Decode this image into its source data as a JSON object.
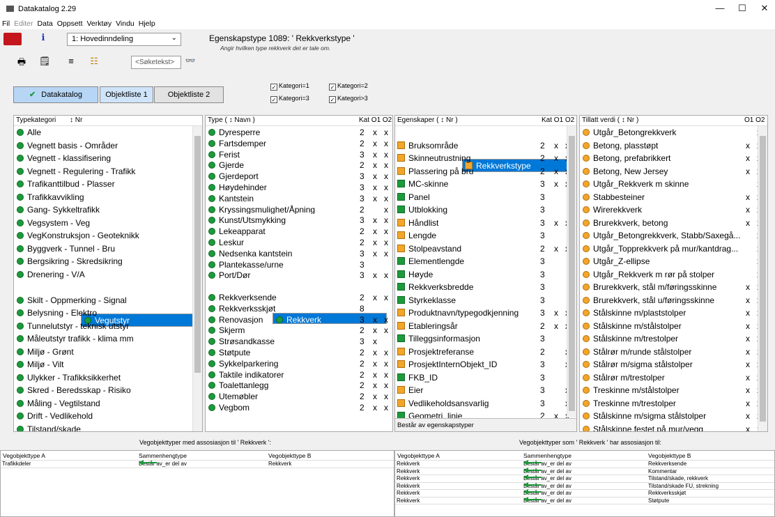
{
  "window": {
    "title": "Datakatalog 2.29",
    "min": "—",
    "max": "☐",
    "close": "✕"
  },
  "menu": [
    {
      "label": "Fil",
      "disabled": false
    },
    {
      "label": "Editer",
      "disabled": true
    },
    {
      "label": "Data",
      "disabled": false
    },
    {
      "label": "Oppsett",
      "disabled": false
    },
    {
      "label": "Verktøy",
      "disabled": false
    },
    {
      "label": "Vindu",
      "disabled": false
    },
    {
      "label": "Hjelp",
      "disabled": false
    }
  ],
  "toolbar": {
    "info": "i",
    "dropdown_value": "1: Hovedinndeling",
    "search_placeholder": "<Søketekst>",
    "print": "🖶",
    "props": "🗒",
    "list": "≡",
    "tree": "☷",
    "binoculars": "👓"
  },
  "egenskap": {
    "title": "Egenskapstype 1089:  ' Rekkverkstype '",
    "subtitle": "Angir hvilken type rekkverk det er tale om."
  },
  "checks": [
    "Kategori=1",
    "Kategori=2",
    "Kategori=3",
    "Kategori>3"
  ],
  "tabs": {
    "datakatalog": "Datakatalog",
    "objektliste1": "Objektliste 1",
    "objektliste2": "Objektliste 2",
    "check": "✔"
  },
  "panels": {
    "typekategori": {
      "header": "Typekategori",
      "nr": "↕ Nr",
      "items": [
        "Alle",
        "Vegnett basis - Områder",
        "Vegnett - klassifisering",
        "Vegnett - Regulering - Trafikk",
        "Trafikanttilbud - Plasser",
        "Trafikkavvikling",
        "Gang- Sykkeltrafikk",
        "Vegsystem - Veg",
        "VegKonstruksjon - Geoteknikk",
        "Byggverk - Tunnel - Bru",
        "Bergsikring - Skredsikring",
        "Drenering - V/A",
        "Vegutstyr",
        "Skilt - Oppmerking - Signal",
        "Belysning - Elektro",
        "Tunnelutstyr - teknisk utstyr",
        "Måleutstyr trafikk - klima mm",
        "Miljø - Grønt",
        "Miljø - Vilt",
        "Ulykker - Trafikksikkerhet",
        "Skred - Beredsskap - Risiko",
        "Måling - Vegtilstand",
        "Drift - Vedlikehold",
        "Tilstand/skade"
      ],
      "selected": 12
    },
    "type": {
      "header": "Type  ( ↕ Navn )",
      "cols": "Kat O1 O2",
      "items": [
        [
          "Dyresperre",
          "2",
          "x",
          "x"
        ],
        [
          "Fartsdemper",
          "2",
          "x",
          "x"
        ],
        [
          "Ferist",
          "3",
          "x",
          "x"
        ],
        [
          "Gjerde",
          "2",
          "x",
          "x"
        ],
        [
          "Gjerdeport",
          "3",
          "x",
          "x"
        ],
        [
          "Høydehinder",
          "3",
          "x",
          "x"
        ],
        [
          "Kantstein",
          "3",
          "x",
          "x"
        ],
        [
          "Kryssingsmulighet/Åpning",
          "2",
          "",
          "x"
        ],
        [
          "Kunst/Utsmykking",
          "3",
          "x",
          "x"
        ],
        [
          "Lekeapparat",
          "2",
          "x",
          "x"
        ],
        [
          "Leskur",
          "2",
          "x",
          "x"
        ],
        [
          "Nedsenka kantstein",
          "3",
          "x",
          "x"
        ],
        [
          "Plantekasse/urne",
          "3",
          "",
          ""
        ],
        [
          "Port/Dør",
          "3",
          "x",
          "x"
        ],
        [
          "Rekkverk",
          "2",
          "x",
          "x"
        ],
        [
          "Rekkverksende",
          "2",
          "x",
          "x"
        ],
        [
          "Rekkverksskjøt",
          "8",
          "",
          ""
        ],
        [
          "Renovasjon",
          "3",
          "x",
          "x"
        ],
        [
          "Skjerm",
          "2",
          "x",
          "x"
        ],
        [
          "Strøsandkasse",
          "3",
          "x",
          ""
        ],
        [
          "Støtpute",
          "2",
          "x",
          "x"
        ],
        [
          "Sykkelparkering",
          "2",
          "x",
          "x"
        ],
        [
          "Taktile indikatorer",
          "2",
          "x",
          "x"
        ],
        [
          "Toalettanlegg",
          "2",
          "x",
          "x"
        ],
        [
          "Utemøbler",
          "2",
          "x",
          "x"
        ],
        [
          "Vegbom",
          "2",
          "x",
          "x"
        ]
      ],
      "selected": 14
    },
    "egenskaper": {
      "header": "Egenskaper  ( ↕ Nr )",
      "cols": "Kat O1 O2",
      "items": [
        [
          "Rekkverkstype",
          "2",
          "x",
          "x"
        ],
        [
          "Bruksområde",
          "2",
          "x",
          "x"
        ],
        [
          "Skinneutrustning",
          "2",
          "x",
          "x"
        ],
        [
          "Plassering på bru",
          "2",
          "x",
          "x"
        ],
        [
          "MC-skinne",
          "3",
          "x",
          "x"
        ],
        [
          "Panel",
          "3",
          "",
          ""
        ],
        [
          "Utblokking",
          "3",
          "",
          ""
        ],
        [
          "Håndlist",
          "3",
          "x",
          "x"
        ],
        [
          "Lengde",
          "3",
          "",
          ""
        ],
        [
          "Stolpeavstand",
          "2",
          "x",
          "x"
        ],
        [
          "Elementlengde",
          "3",
          "",
          ""
        ],
        [
          "Høyde",
          "3",
          "",
          ""
        ],
        [
          "Rekkverksbredde",
          "3",
          "",
          ""
        ],
        [
          "Styrkeklasse",
          "3",
          "",
          ""
        ],
        [
          "Produktnavn/typegodkjenning",
          "3",
          "x",
          "x"
        ],
        [
          "Etableringsår",
          "2",
          "x",
          "x"
        ],
        [
          "Tilleggsinformasjon",
          "3",
          "",
          ""
        ],
        [
          "Prosjektreferanse",
          "2",
          "",
          "x"
        ],
        [
          "ProsjektInternObjekt_ID",
          "3",
          "",
          "x"
        ],
        [
          "FKB_ID",
          "3",
          "",
          ""
        ],
        [
          "Eier",
          "3",
          "",
          "x"
        ],
        [
          "Vedlikeholdsansvarlig",
          "3",
          "",
          "x"
        ],
        [
          "Geometri, linje",
          "2",
          "x",
          "x"
        ]
      ],
      "selected": 0,
      "footer": "Består av egenskapstyper"
    },
    "tillatt": {
      "header": "Tillatt verdi  ( ↕ Nr )",
      "cols": "O1 O2",
      "items": [
        [
          "Utgår_Betongrekkverk",
          "",
          "x"
        ],
        [
          "Betong, plasstøpt",
          "x",
          "x"
        ],
        [
          "Betong, prefabrikkert",
          "x",
          "x"
        ],
        [
          "Betong, New Jersey",
          "x",
          "x"
        ],
        [
          "Utgår_Rekkverk m skinne",
          "",
          "x"
        ],
        [
          "Stabbesteiner",
          "x",
          "x"
        ],
        [
          "Wirerekkverk",
          "x",
          "x"
        ],
        [
          "Brurekkverk, betong",
          "x",
          "x"
        ],
        [
          "Utgår_Betongrekkverk, Stabb/Saxegå...",
          "",
          "x"
        ],
        [
          "Utgår_Topprekkverk på mur/kantdrag...",
          "",
          "x"
        ],
        [
          "Utgår_Z-ellipse",
          "",
          "x"
        ],
        [
          "Utgår_Rekkverk m rør på stolper",
          "",
          "x"
        ],
        [
          "Brurekkverk, stål m/føringsskinne",
          "x",
          "x"
        ],
        [
          "Brurekkverk, stål u/føringsskinne",
          "x",
          "x"
        ],
        [
          "Stålskinne m/plaststolper",
          "x",
          "x"
        ],
        [
          "Stålskinne m/stålstolper",
          "x",
          "x"
        ],
        [
          "Stålskinne m/trestolper",
          "x",
          "x"
        ],
        [
          "Stålrør m/runde stålstolper",
          "x",
          "x"
        ],
        [
          "Stålrør m/sigma stålstolper",
          "x",
          "x"
        ],
        [
          "Stålrør m/trestolper",
          "x",
          "x"
        ],
        [
          "Treskinne m/stålstolper",
          "x",
          "x"
        ],
        [
          "Treskinne m/trestolper",
          "x",
          "x"
        ],
        [
          "Stålskinne m/sigma stålstolper",
          "x",
          "x"
        ],
        [
          "Stålskinne festet på mur/vegg",
          "x",
          "x"
        ]
      ]
    }
  },
  "assoc_left": {
    "title": "Vegobjekttyper med assosiasjon til ' Rekkverk ':",
    "cols": [
      "Vegobjekttype A",
      "Sammenhengtype",
      "Vegobjekttype B"
    ],
    "rows": [
      [
        "Trafikkdeler",
        "Består av_er del av",
        "Rekkverk"
      ]
    ]
  },
  "assoc_right": {
    "title": "Vegobjekttyper som ' Rekkverk ' har assosiasjon til:",
    "cols": [
      "Vegobjekttype A",
      "Sammenhengtype",
      "Vegobjekttype B"
    ],
    "rows": [
      [
        "Rekkverk",
        "Består av_er del av",
        "Rekkverksende"
      ],
      [
        "Rekkverk",
        "Består av_er del av",
        "Kommentar"
      ],
      [
        "Rekkverk",
        "Består av_er del av",
        "Tilstand/skade, rekkverk"
      ],
      [
        "Rekkverk",
        "Består av_er del av",
        "Tilstand/skade FU, strekning"
      ],
      [
        "Rekkverk",
        "Består av_er del av",
        "Rekkverksskjøt"
      ],
      [
        "Rekkverk",
        "Består av_er del av",
        "Støtpute"
      ]
    ]
  }
}
